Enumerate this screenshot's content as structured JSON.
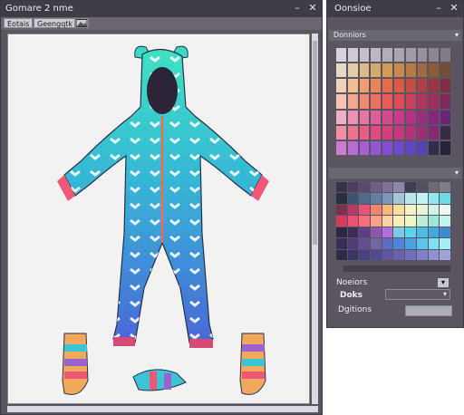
{
  "main_window": {
    "title": "Gomare 2 nme",
    "toolbar": {
      "btn1": "Eotais",
      "btn2": "Geengqtk",
      "btn3_icon": "image-icon"
    },
    "controls": {
      "minimize": "–",
      "close": "✕"
    }
  },
  "side_window": {
    "title": "Oonsioe",
    "controls": {
      "minimize": "–",
      "close": "✕"
    },
    "swatches_header": "Donniors",
    "mixer_header": "",
    "fields": {
      "label1": "Noeiors",
      "label2": "Doks",
      "label3": "Dgitions"
    },
    "palette_rows": [
      [
        "#d8d3dc",
        "#cfc9d4",
        "#c6c0cc",
        "#bdb7c3",
        "#b3adb9",
        "#aaa3b0",
        "#a19aa7",
        "#978f9e",
        "#8d8594",
        "#837b8a"
      ],
      [
        "#e6d9c6",
        "#e3cba8",
        "#ddbb87",
        "#d7aa6a",
        "#d19b55",
        "#c7894a",
        "#b57a44",
        "#9f6b3e",
        "#895d38",
        "#724f31"
      ],
      [
        "#f1d2b6",
        "#f0be94",
        "#ee9e70",
        "#ea8458",
        "#e46b4a",
        "#da5a46",
        "#c74b45",
        "#b23f44",
        "#9a3544",
        "#7e2d42"
      ],
      [
        "#f5c3b0",
        "#f4a78f",
        "#f28a72",
        "#ef6e62",
        "#ea5a5b",
        "#e14a5a",
        "#cf3d5c",
        "#b8345d",
        "#9d2f5c",
        "#7f2a59"
      ],
      [
        "#f0aec6",
        "#ec91b4",
        "#e676a4",
        "#df5e98",
        "#d6498f",
        "#ca3a89",
        "#b53186",
        "#9c2b82",
        "#83287c",
        "#692575"
      ],
      [
        "#f28fa2",
        "#ee7191",
        "#ea5c86",
        "#e24b80",
        "#d73e7d",
        "#c8367c",
        "#b4317b",
        "#9e2c79",
        "#842877",
        "#3b2c44"
      ],
      [
        "#cc7bd0",
        "#b86bd1",
        "#a65fd2",
        "#9356d2",
        "#804fd0",
        "#6f49cc",
        "#6046c5",
        "#5443ba",
        "#2f2e4c",
        "#26243a"
      ]
    ],
    "mixer_rows": [
      [
        "#3a3146",
        "#4b3d5b",
        "#5a4a6b",
        "#6e5e82",
        "#7f7296",
        "#8f86a9",
        "#3d4050",
        "#50535e",
        "#6c6a75",
        "#7f7d88"
      ],
      [
        "#26303e",
        "#3e5570",
        "#4f6a8a",
        "#657fa4",
        "#7b97be",
        "#a2c6dc",
        "#b8e7f0",
        "#c5f1f4",
        "#8fe9ee",
        "#6cdde7"
      ],
      [
        "#7c3050",
        "#b43e63",
        "#e75476",
        "#f3856f",
        "#f6b878",
        "#fae09a",
        "#f3f5c4",
        "#e8f6d5",
        "#d4f3e8",
        "#eef9f6"
      ],
      [
        "#d83a5c",
        "#ef4f72",
        "#f4707d",
        "#f7a187",
        "#fbd3a1",
        "#f8f0b8",
        "#e9f8c6",
        "#b9f0cf",
        "#9ee7d9",
        "#c2f3ef"
      ],
      [
        "#2b2840",
        "#3c2d58",
        "#5d3f86",
        "#8d56b5",
        "#b56ddc",
        "#7cc9e8",
        "#5ad5ee",
        "#4dbde6",
        "#46a6dd",
        "#3c8bd1"
      ],
      [
        "#3a2d57",
        "#4e3b78",
        "#62508f",
        "#7566a3",
        "#5d6fc2",
        "#4c86d8",
        "#48a2e2",
        "#5cc4ea",
        "#7ee0f0",
        "#a3eff6"
      ],
      [
        "#2e2a49",
        "#393566",
        "#46417f",
        "#514c92",
        "#5b57a2",
        "#6562b0",
        "#7170bd",
        "#7f80c8",
        "#8f91d2",
        "#a0a2da"
      ]
    ]
  }
}
